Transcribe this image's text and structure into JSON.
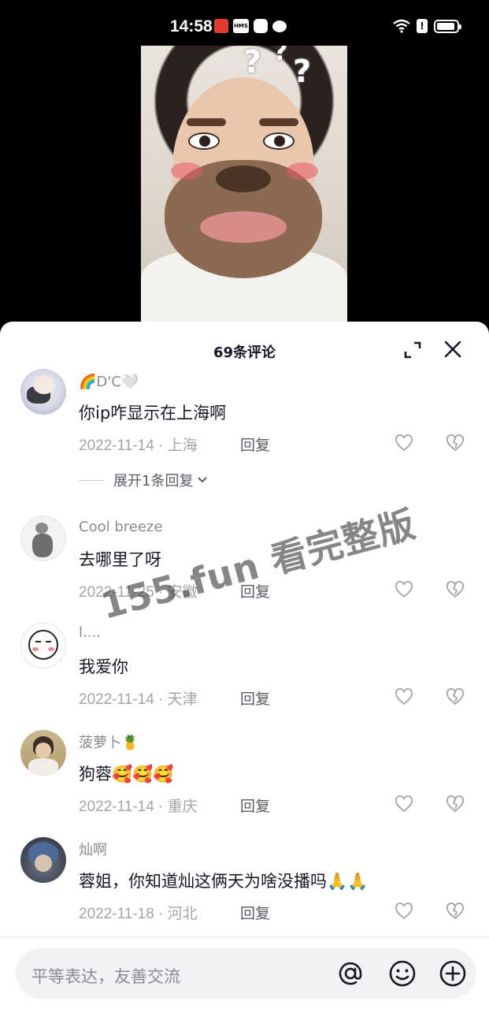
{
  "status_bar": {
    "time": "14:58"
  },
  "header": {
    "title": "69条评论"
  },
  "comments": [
    {
      "username": "🌈D'C🤍",
      "text": "你ip咋显示在上海啊",
      "date": "2022-11-14",
      "location": "上海",
      "reply_label": "回复",
      "expand_label": "展开1条回复"
    },
    {
      "username": "Cool breeze",
      "text": "去哪里了呀",
      "date": "2022-11-25",
      "location": "安徽",
      "reply_label": "回复"
    },
    {
      "username": "l....",
      "text": "我爱你",
      "date": "2022-11-14",
      "location": "天津",
      "reply_label": "回复"
    },
    {
      "username": "菠萝卜🍍",
      "text": "狗蓉🥰🥰🥰",
      "date": "2022-11-14",
      "location": "重庆",
      "reply_label": "回复"
    },
    {
      "username": "灿啊",
      "text": "蓉姐，你知道灿这俩天为啥没播吗🙏🙏",
      "date": "2022-11-18",
      "location": "河北",
      "reply_label": "回复"
    }
  ],
  "meta_separator": " · ",
  "watermark": "155.fun 看完整版",
  "input": {
    "placeholder": "平等表达，友善交流"
  },
  "colors": {
    "text_primary": "#161823",
    "text_secondary": "#8a8b91",
    "meta": "#a3a4aa"
  },
  "icons": [
    "expand-icon",
    "close-icon",
    "heart-icon",
    "broken-heart-icon",
    "at-icon",
    "emoji-icon",
    "plus-icon",
    "chevron-down-icon"
  ]
}
